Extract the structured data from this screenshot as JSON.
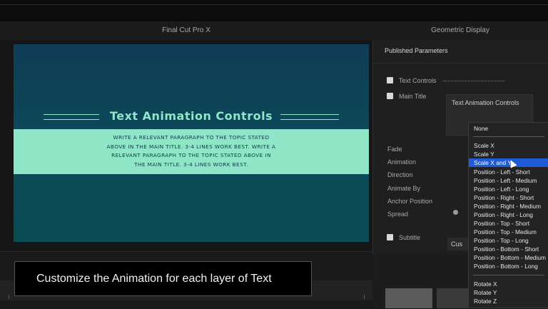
{
  "header": {
    "left_title": "Final Cut Pro X",
    "right_title": "Geometric Display"
  },
  "preview": {
    "title": "Text Animation Controls",
    "paragraph_lines": [
      "WRITE A RELEVANT PARAGRAPH TO THE TOPIC STATED",
      "ABOVE IN THE MAIN TITLE. 3-4 LINES WORK BEST. WRITE A",
      "RELEVANT PARAGRAPH TO THE TOPIC STATED ABOVE IN",
      "THE MAIN TITLE. 3-4 LINES WORK BEST."
    ],
    "accent_color": "#8fe6c6",
    "background_color": "#0c4a58"
  },
  "inspector": {
    "section_title": "Published Parameters",
    "text_controls_label": "Text Controls",
    "main_title_label": "Main Title",
    "animation_controls_label": "Text Animation Controls",
    "params": [
      "Fade",
      "Animation",
      "Direction",
      "Animate By",
      "Anchor Position",
      "Spread"
    ],
    "subtitle_label": "Subtitle",
    "custom_box_label": "Cus"
  },
  "dropdown": {
    "items": [
      "None",
      "---",
      "Scale X",
      "Scale Y",
      "Scale X and Y",
      "Position - Left - Short",
      "Position - Left - Medium",
      "Position - Left - Long",
      "Position - Right - Short",
      "Position - Right - Medium",
      "Position - Right - Long",
      "Position - Top - Short",
      "Position - Top - Medium",
      "Position - Top - Long",
      "Position - Bottom - Short",
      "Position - Bottom - Medium",
      "Position - Bottom - Long",
      "---",
      "Rotate X",
      "Rotate Y",
      "Rotate Z"
    ],
    "selected": "Scale X and Y",
    "selected_color": "#1f5bd6"
  },
  "caption": {
    "text": "Customize the Animation for each layer of Text"
  }
}
